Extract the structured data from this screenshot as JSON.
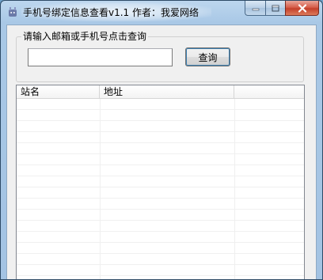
{
  "window": {
    "title": "手机号绑定信息查看v1.1  作者：我爱网络",
    "icon": "app-icon",
    "colors": {
      "close_button": "#c4402a",
      "title_bar": "#a9c8e6"
    }
  },
  "search": {
    "group_label": "请输入邮箱或手机号点击查询",
    "input_value": "",
    "input_placeholder": "",
    "button_label": "查询"
  },
  "results": {
    "columns": [
      "站名",
      "地址",
      ""
    ],
    "rows": []
  }
}
